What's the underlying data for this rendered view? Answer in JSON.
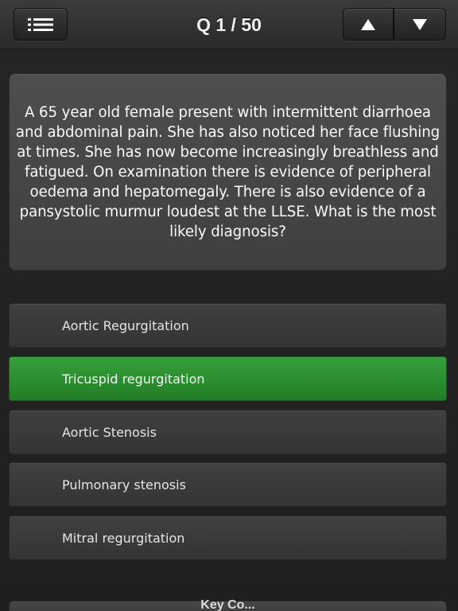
{
  "header": {
    "title": "Q 1 / 50",
    "menu_icon": "list-menu-icon",
    "up_icon": "triangle-up-icon",
    "down_icon": "triangle-down-icon"
  },
  "question": {
    "text": "A 65 year old female present with intermittent diarrhoea and abdominal pain. She has also noticed her face flushing at times. She has now become increasingly breathless and fatigued. On examination there is evidence of peripheral oedema and hepatomegaly. There is also evidence of a pansystolic murmur loudest at the LLSE. What is the most likely diagnosis?"
  },
  "answers": [
    {
      "label": "Aortic Regurgitation",
      "state": "default"
    },
    {
      "label": "Tricuspid regurgitation",
      "state": "correct"
    },
    {
      "label": "Aortic Stenosis",
      "state": "default"
    },
    {
      "label": "Pulmonary stenosis",
      "state": "default"
    },
    {
      "label": "Mitral regurgitation",
      "state": "default"
    }
  ],
  "bottom": {
    "label": "Key Co..."
  },
  "colors": {
    "correct": "#2e8f32",
    "card": "#474747",
    "background": "#242424"
  }
}
